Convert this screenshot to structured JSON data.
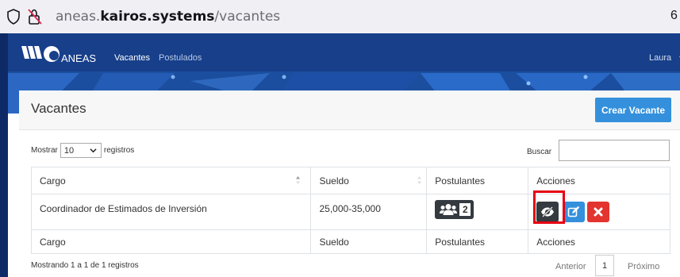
{
  "browser": {
    "url_prefix": "aneas.",
    "url_domain": "kairos.systems",
    "url_path": "/vacantes",
    "tab_count": "6"
  },
  "navbar": {
    "brand": "ANEAS",
    "links": [
      "Vacantes",
      "Postulados"
    ],
    "user": "Laura"
  },
  "card": {
    "title": "Vacantes",
    "create_button": "Crear Vacante"
  },
  "table_controls": {
    "show_prefix": "Mostrar",
    "page_size": "10",
    "show_suffix": "registros",
    "search_label": "Buscar",
    "search_value": ""
  },
  "table": {
    "columns": [
      "Cargo",
      "Sueldo",
      "Postulantes",
      "Acciones"
    ],
    "rows": [
      {
        "cargo": "Coordinador de Estimados de Inversión",
        "sueldo": "25,000-35,000",
        "postulantes": "2"
      }
    ],
    "footer_columns": [
      "Cargo",
      "Sueldo",
      "Postulantes",
      "Acciones"
    ]
  },
  "pagination": {
    "info": "Mostrando 1 a 1 de 1 registros",
    "prev": "Anterior",
    "current": "1",
    "next": "Próximo"
  },
  "colors": {
    "primary": "#3490dc",
    "danger": "#e3342f",
    "dark": "#343a40",
    "banner": "#1a4fa2",
    "highlight": "#e60012"
  },
  "icons": {
    "view": "eye-slash-icon",
    "edit": "edit-icon",
    "delete": "close-icon",
    "postulantes": "users-icon"
  }
}
